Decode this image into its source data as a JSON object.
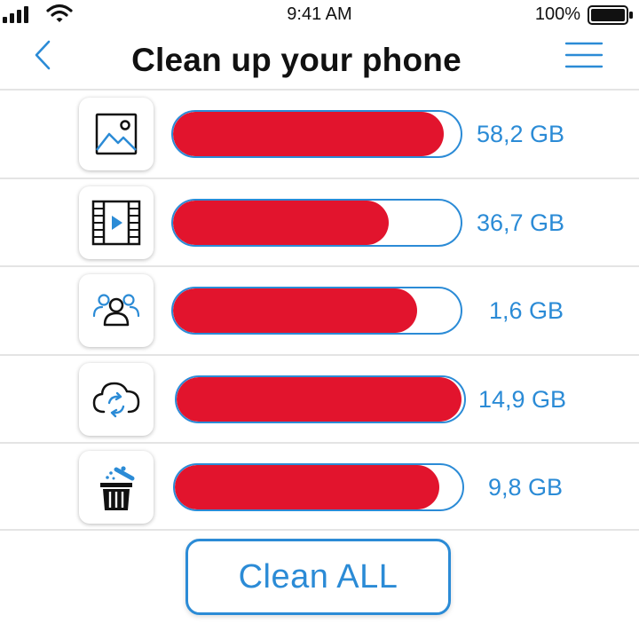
{
  "status_bar": {
    "time": "9:41 AM",
    "battery_percent": "100%",
    "battery_level": 1.0,
    "signal_icon": "cellular-signal-icon",
    "wifi_icon": "wifi-icon",
    "battery_icon": "battery-icon"
  },
  "header": {
    "title": "Clean up your phone",
    "back_icon": "chevron-left-icon",
    "menu_icon": "hamburger-menu-icon"
  },
  "rows": [
    {
      "category_icon": "photos-icon",
      "size": "58,2 GB",
      "fill": 0.94
    },
    {
      "category_icon": "videos-icon",
      "size": "36,7 GB",
      "fill": 0.75
    },
    {
      "category_icon": "contacts-icon",
      "size": "1,6 GB",
      "fill": 0.85
    },
    {
      "category_icon": "cloud-sync-icon",
      "size": "14,9 GB",
      "fill": 0.99
    },
    {
      "category_icon": "trash-icon",
      "size": "9,8 GB",
      "fill": 0.92
    }
  ],
  "clean_button": {
    "label": "Clean ALL"
  },
  "colors": {
    "accent": "#2b8bd6",
    "bar_fill": "#e2142d",
    "divider": "#e4e4e4"
  }
}
